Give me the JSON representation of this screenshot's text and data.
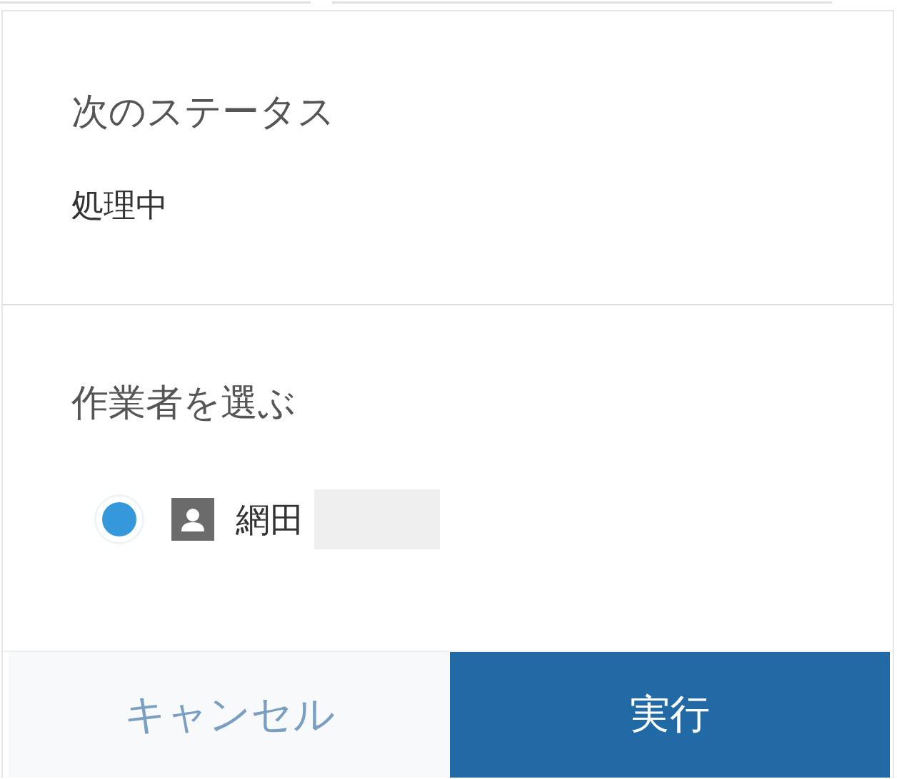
{
  "next_status": {
    "label": "次のステータス",
    "value": "処理中"
  },
  "assignee": {
    "label": "作業者を選ぶ",
    "options": [
      {
        "name": "網田",
        "selected": true,
        "redacted": true
      }
    ]
  },
  "buttons": [
    {
      "label": "キャンセル",
      "kind": "cancel"
    },
    {
      "label": "実行",
      "kind": "primary"
    }
  ]
}
